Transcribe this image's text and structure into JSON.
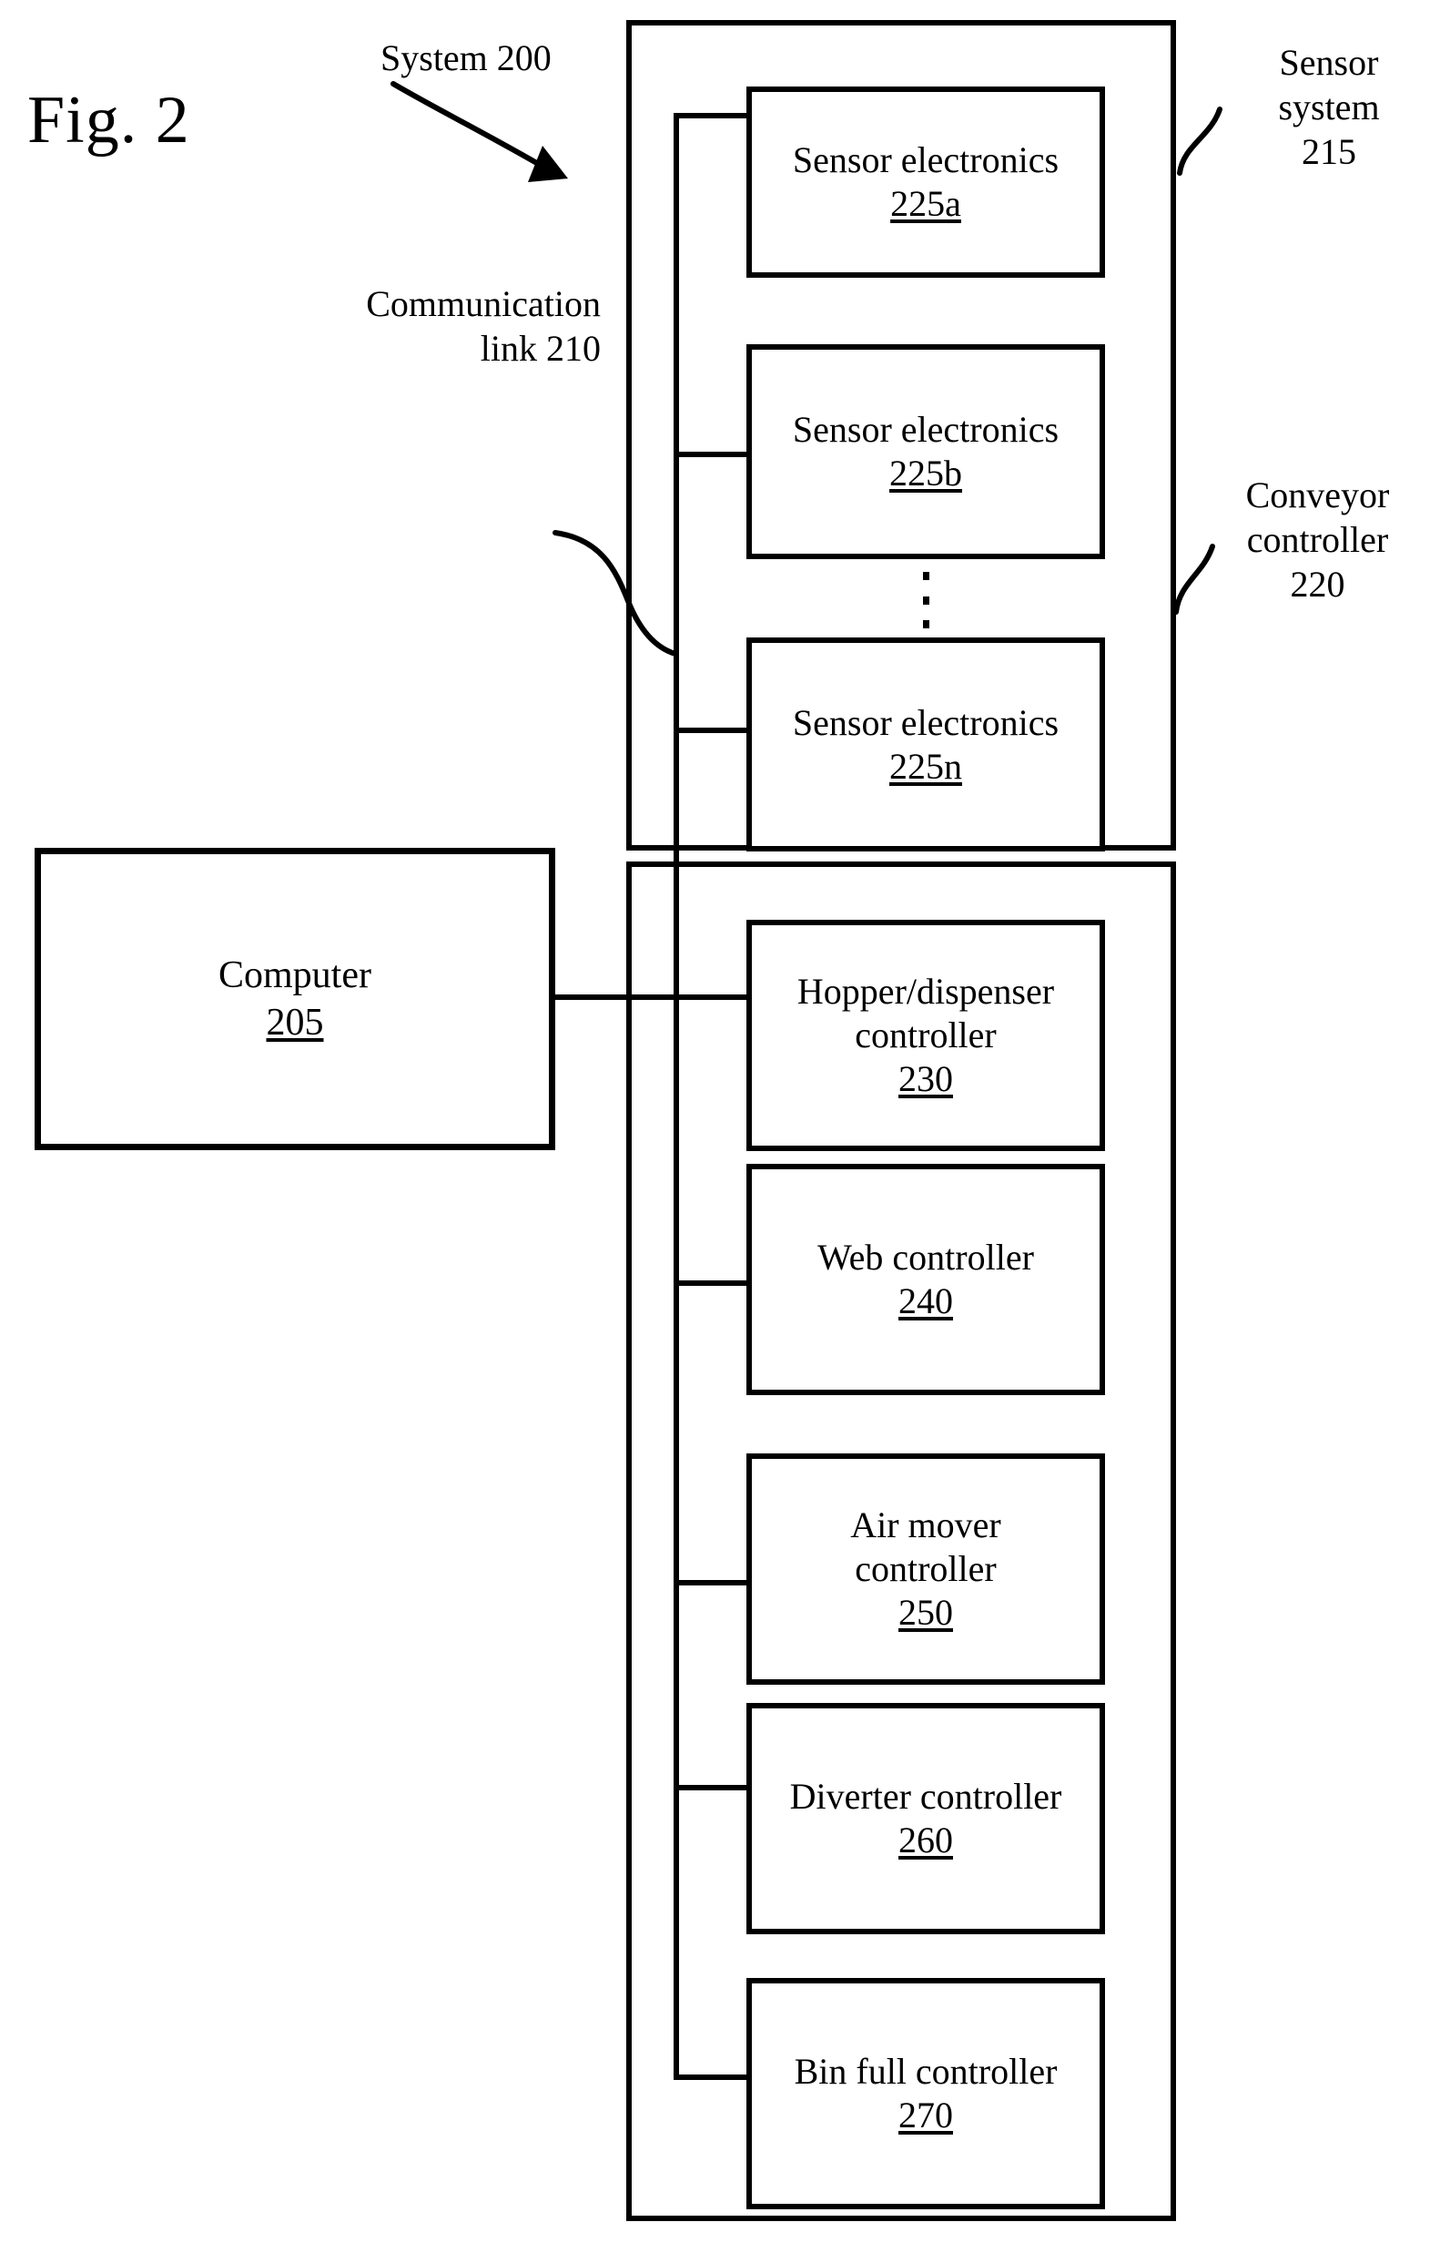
{
  "figure": {
    "label": "Fig. 2"
  },
  "callouts": {
    "system": "System 200",
    "communication_link": "Communication\nlink 210",
    "sensor_system": "Sensor\nsystem\n215",
    "conveyor_controller": "Conveyor\ncontroller\n220"
  },
  "computer": {
    "title": "Computer",
    "ref": "205"
  },
  "sensor_system": {
    "blocks": [
      {
        "title": "Sensor electronics",
        "ref": "225a"
      },
      {
        "title": "Sensor electronics",
        "ref": "225b"
      },
      {
        "title": "Sensor electronics",
        "ref": "225n"
      }
    ],
    "ellipsis": "vertical-dots"
  },
  "conveyor_controller": {
    "blocks": [
      {
        "title": "Hopper/dispenser\ncontroller",
        "ref": "230"
      },
      {
        "title": "Web controller",
        "ref": "240"
      },
      {
        "title": "Air mover\ncontroller",
        "ref": "250"
      },
      {
        "title": "Diverter controller",
        "ref": "260"
      },
      {
        "title": "Bin full controller",
        "ref": "270"
      }
    ]
  },
  "colors": {
    "ink": "#000000",
    "paper": "#ffffff"
  }
}
